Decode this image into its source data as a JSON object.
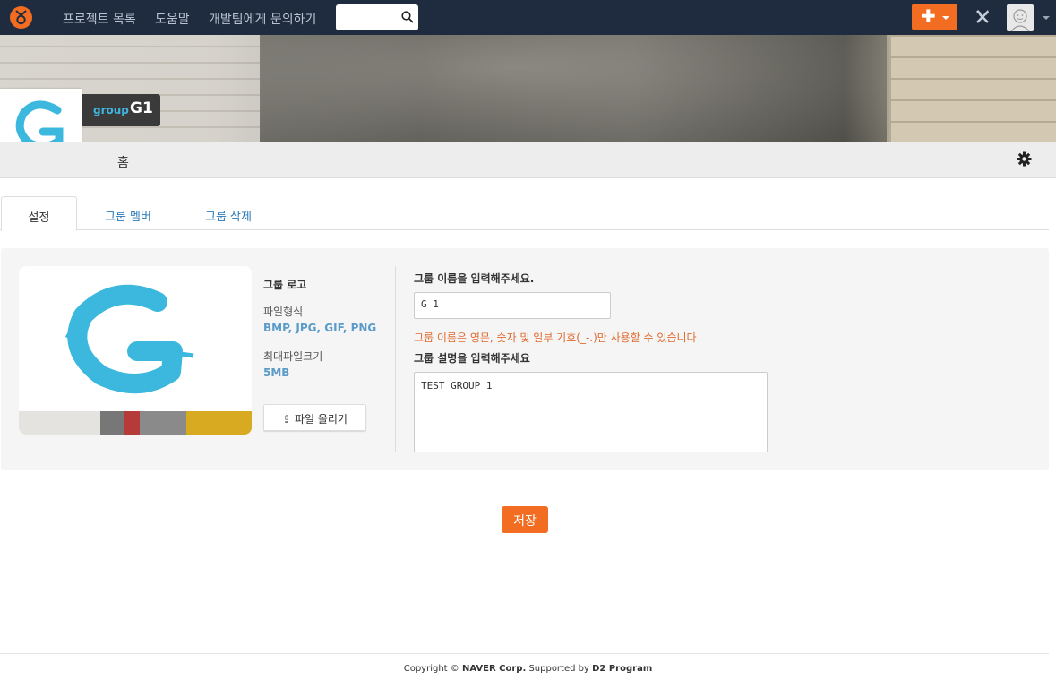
{
  "topnav": {
    "links": [
      "프로젝트 목록",
      "도움말",
      "개발팀에게 문의하기"
    ],
    "search_placeholder": "",
    "colors": {
      "bg": "#1f2b3f",
      "accent": "#f26d21"
    }
  },
  "group": {
    "type_label": "group",
    "name": "G1"
  },
  "subnav": {
    "home_label": "홈"
  },
  "tabs": [
    "설정",
    "그룹 멤버",
    "그룹 삭제"
  ],
  "logo_section": {
    "title": "그룹 로고",
    "format_label": "파일형식",
    "format_value": "BMP, JPG, GIF, PNG",
    "size_label": "최대파일크기",
    "size_value": "5MB",
    "upload_label": "파일 올리기"
  },
  "form": {
    "name_label": "그룹 이름을 입력해주세요.",
    "name_value": "G 1",
    "name_hint": "그룹 이름은 영문, 숫자 및 일부 기호(_-.)만 사용할 수 있습니다",
    "desc_label": "그룹 설명을 입력해주세요",
    "desc_value": "TEST GROUP 1",
    "save_label": "저장"
  },
  "footer": {
    "copyright": "Copyright ©",
    "company": "NAVER Corp.",
    "supported": "Supported by",
    "program": "D2 Program"
  }
}
